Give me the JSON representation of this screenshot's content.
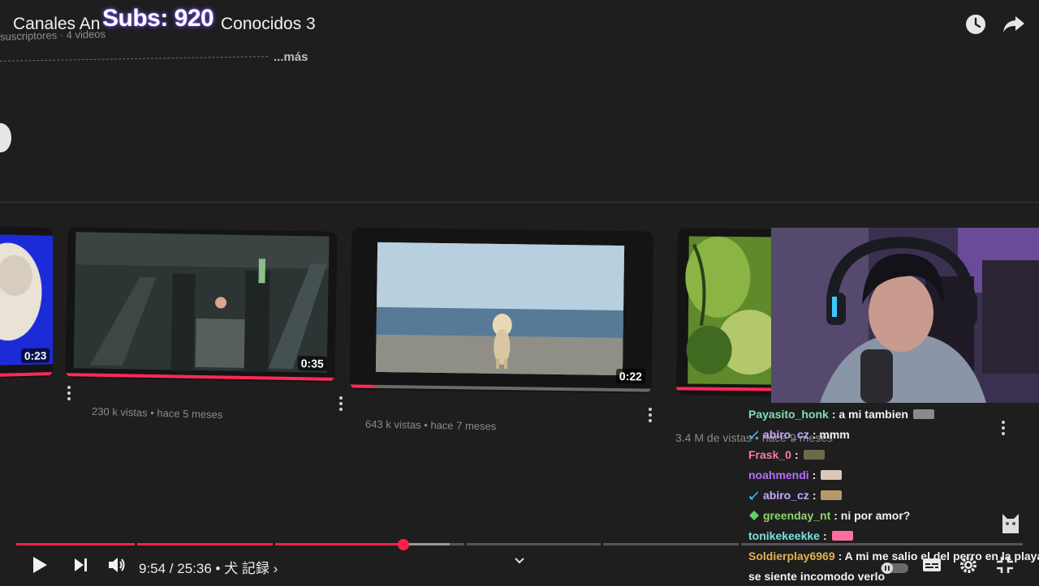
{
  "overlay": {
    "subs": "Subs: 920"
  },
  "header": {
    "title_left": "Canales An",
    "title_right": "Conocidos 3",
    "meta": "suscriptores · 4 videos",
    "more": "...más"
  },
  "videos": [
    {
      "duration": "0:23",
      "views": ""
    },
    {
      "duration": "0:35",
      "views": "230 k vistas • hace 5 meses"
    },
    {
      "duration": "0:22",
      "views": "643 k vistas • hace 7 meses"
    },
    {
      "duration": "",
      "views": "3.4 M de vistas • hace 9 meses"
    }
  ],
  "chat": [
    {
      "user": "Payasito_honk",
      "color": "#7ee0b0",
      "msg": ": a mi tambien",
      "badge": "",
      "emote": "#8a8a8a"
    },
    {
      "user": "abiro_cz",
      "color": "#c7a8ff",
      "msg": ": mmm",
      "badge": "sword",
      "emote": ""
    },
    {
      "user": "Frask_0",
      "color": "#ff7aa0",
      "msg": ":",
      "badge": "",
      "emote": "#6d6a4a"
    },
    {
      "user": "noahmendi",
      "color": "#b96cff",
      "msg": ":",
      "badge": "",
      "emote": "#d9c9b9"
    },
    {
      "user": "abiro_cz",
      "color": "#c7a8ff",
      "msg": ":",
      "badge": "sword",
      "emote": "#b49a6a"
    },
    {
      "user": "greenday_nt",
      "color": "#8fd66a",
      "msg": ": ni por amor?",
      "badge": "gem",
      "emote": ""
    },
    {
      "user": "tonikekeekke",
      "color": "#7ee0e0",
      "msg": ":",
      "badge": "",
      "emote": "#ff6fa0"
    },
    {
      "user": "Soldierplay6969",
      "color": "#e6b24a",
      "msg": ": A mi me salio el del perro en la playa",
      "badge": "",
      "emote": ""
    },
    {
      "user": "",
      "color": "#f2f2f2",
      "msg": "se siente incomodo verlo",
      "badge": "",
      "emote": ""
    }
  ],
  "player": {
    "time": "9:54 / 25:36 • 犬 記録 ›",
    "progress_fraction": 0.386
  },
  "icons": {
    "clock": "watch-later-icon",
    "share": "share-icon",
    "play": "play-icon",
    "next": "next-icon",
    "volume": "volume-icon",
    "subtitles": "subtitles-icon",
    "settings": "gear-icon",
    "exit_fullscreen": "exit-fullscreen-icon",
    "autoplay": "autoplay-toggle"
  },
  "colors": {
    "accent": "#ff1f4b",
    "background": "#1e1e1f"
  }
}
